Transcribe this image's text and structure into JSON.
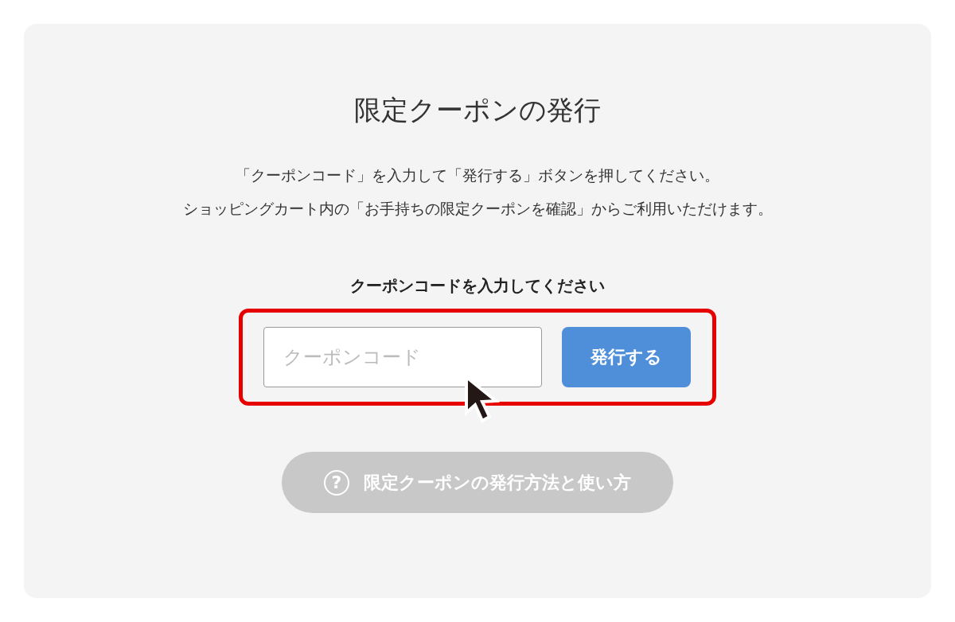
{
  "title": "限定クーポンの発行",
  "instructions": [
    "「クーポンコード」を入力して「発行する」ボタンを押してください。",
    "ショッピングカート内の「お手持ちの限定クーポンを確認」からご利用いただけます。"
  ],
  "form": {
    "label": "クーポンコードを入力してください",
    "input": {
      "placeholder": "クーポンコード"
    },
    "submit": "発行する"
  },
  "help": {
    "icon": "?",
    "label": "限定クーポンの発行方法と使い方"
  }
}
